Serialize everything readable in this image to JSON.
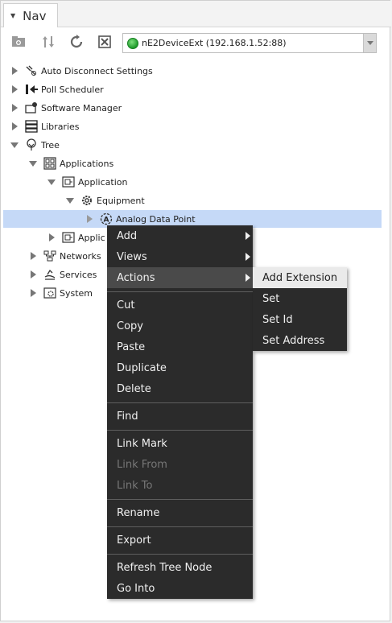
{
  "panel": {
    "title": "Nav"
  },
  "toolbar": {
    "buttons": [
      {
        "icon": "new-folder-icon"
      },
      {
        "icon": "sort-icon"
      },
      {
        "icon": "refresh-icon"
      },
      {
        "icon": "close-box-icon"
      }
    ],
    "device": {
      "label": "nE2DeviceExt (192.168.1.52:88)",
      "status_color": "#22a832"
    }
  },
  "tree": {
    "items": [
      {
        "label": "Auto Disconnect Settings",
        "icon": "plug-icon"
      },
      {
        "label": "Poll Scheduler",
        "icon": "poll-icon"
      },
      {
        "label": "Software Manager",
        "icon": "software-icon"
      },
      {
        "label": "Libraries",
        "icon": "library-icon"
      },
      {
        "label": "Tree",
        "icon": "tree-icon"
      },
      {
        "label": "Applications",
        "icon": "applications-icon"
      },
      {
        "label": "Application",
        "icon": "application-icon"
      },
      {
        "label": "Equipment",
        "icon": "gear-icon"
      },
      {
        "label": "Analog Data Point",
        "icon": "analog-point-icon"
      },
      {
        "label": "Applic",
        "icon": "application-icon"
      },
      {
        "label": "Networks",
        "icon": "network-icon"
      },
      {
        "label": "Services",
        "icon": "services-icon"
      },
      {
        "label": "System",
        "icon": "system-icon"
      }
    ]
  },
  "context_menu": {
    "items": [
      {
        "label": "Add"
      },
      {
        "label": "Views"
      },
      {
        "label": "Actions"
      },
      {
        "label": "Cut"
      },
      {
        "label": "Copy"
      },
      {
        "label": "Paste"
      },
      {
        "label": "Duplicate"
      },
      {
        "label": "Delete"
      },
      {
        "label": "Find"
      },
      {
        "label": "Link Mark"
      },
      {
        "label": "Link From"
      },
      {
        "label": "Link To"
      },
      {
        "label": "Rename"
      },
      {
        "label": "Export"
      },
      {
        "label": "Refresh Tree Node"
      },
      {
        "label": "Go Into"
      }
    ]
  },
  "actions_submenu": {
    "items": [
      {
        "label": "Add Extension"
      },
      {
        "label": "Set"
      },
      {
        "label": "Set Id"
      },
      {
        "label": "Set Address"
      }
    ]
  }
}
